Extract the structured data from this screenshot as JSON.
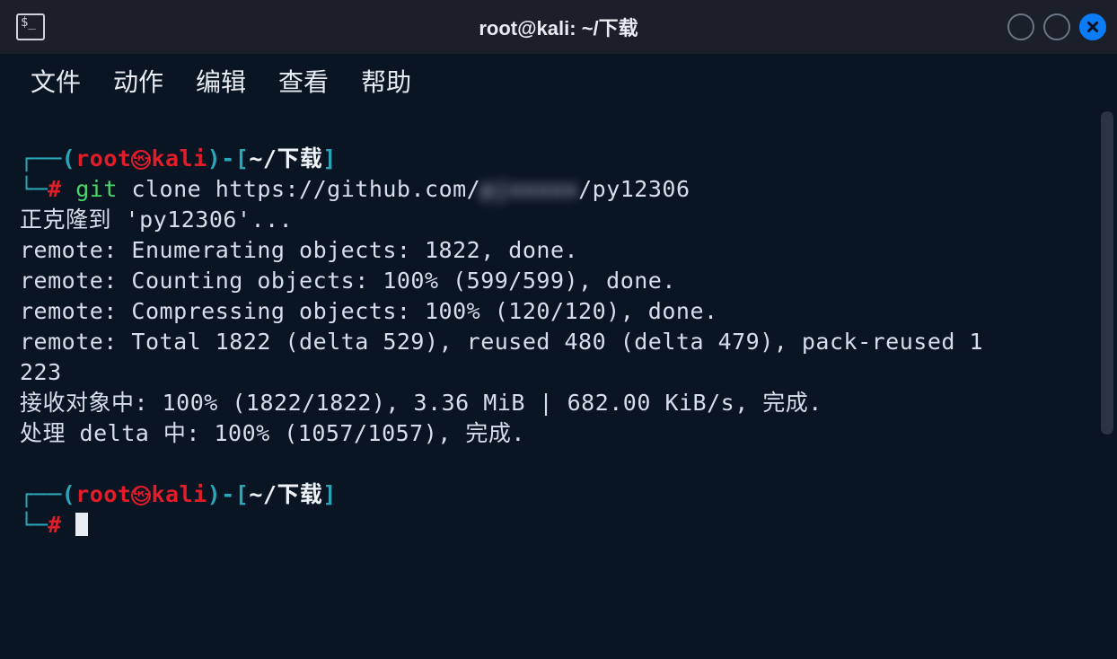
{
  "titlebar": {
    "title": "root@kali: ~/下载",
    "app_icon_glyph": "$_"
  },
  "menubar": {
    "items": [
      "文件",
      "动作",
      "编辑",
      "查看",
      "帮助"
    ]
  },
  "prompt": {
    "user": "root",
    "host": "kali",
    "path": "~/下载",
    "symbol": "#"
  },
  "command": {
    "bin": "git",
    "args_pre": " clone https://github.com/",
    "redacted": "pjxxxxx",
    "args_post": "/py12306"
  },
  "git_output": {
    "line1": "正克隆到 'py12306'...",
    "line2": "remote: Enumerating objects: 1822, done.",
    "line3": "remote: Counting objects: 100% (599/599), done.",
    "line4": "remote: Compressing objects: 100% (120/120), done.",
    "line5": "remote: Total 1822 (delta 529), reused 480 (delta 479), pack-reused 1",
    "line6": "223",
    "line7": "接收对象中: 100% (1822/1822), 3.36 MiB | 682.00 KiB/s, 完成.",
    "line8": "处理 delta 中: 100% (1057/1057), 完成."
  }
}
